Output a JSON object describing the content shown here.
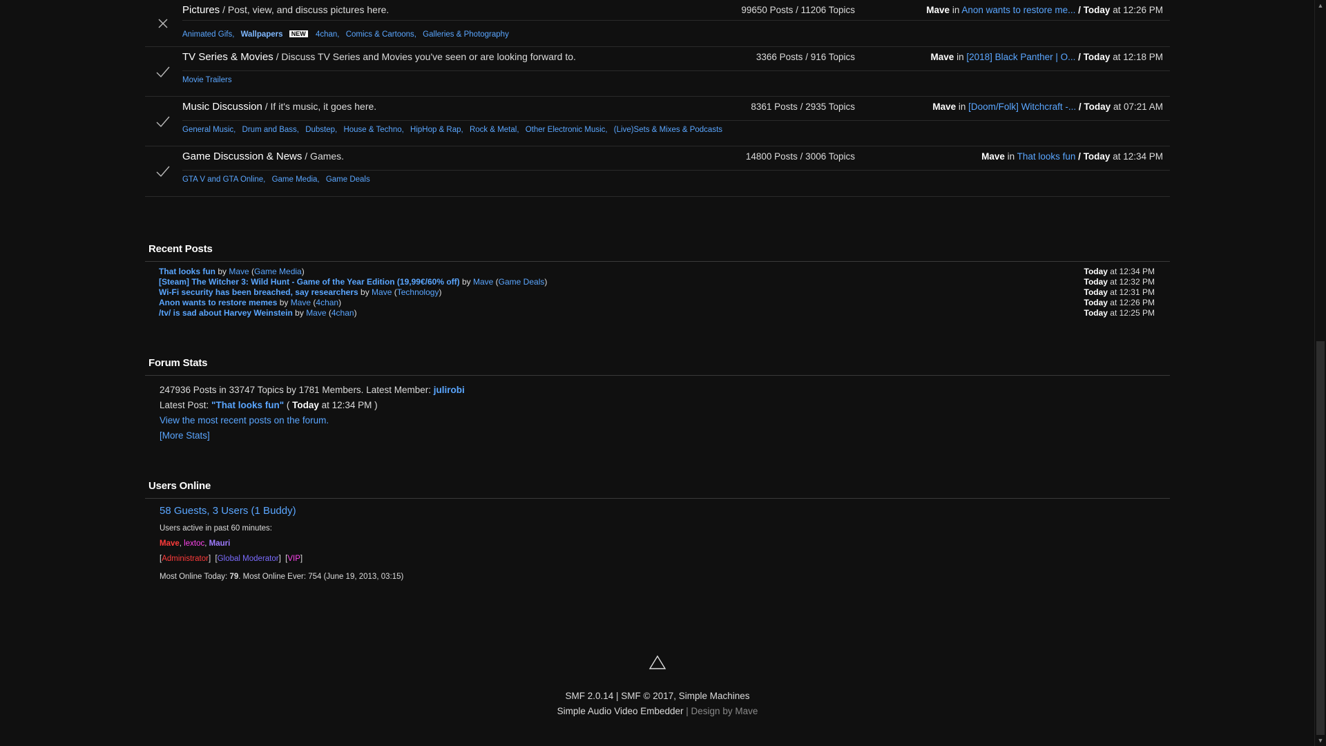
{
  "boards": [
    {
      "title": "Pictures",
      "desc": " / Post, view, and discuss pictures here.",
      "stats": "99650 Posts / 11206 Topics",
      "last_user": "Mave",
      "last_in": " in ",
      "last_topic": "Anon wants to restore me...",
      "last_sep": " / ",
      "last_day": "Today",
      "last_time": " at 12:26 PM",
      "icon": "x-icon",
      "children": [
        "Animated Gifs,",
        "Wallpapers",
        "4chan,",
        "Comics & Cartoons,",
        "Galleries & Photography"
      ],
      "new_badge": "NEW"
    },
    {
      "title": "TV Series & Movies",
      "desc": " / Discuss TV Series and Movies you've seen or are looking forward to.",
      "stats": "3366 Posts / 916 Topics",
      "last_user": "Mave",
      "last_in": " in ",
      "last_topic": "[2018] Black Panther | O...",
      "last_sep": " / ",
      "last_day": "Today",
      "last_time": " at 12:18 PM",
      "icon": "check-icon",
      "children": [
        "Movie Trailers"
      ]
    },
    {
      "title": "Music Discussion",
      "desc": " / If it's music, it goes here.",
      "stats": "8361 Posts / 2935 Topics",
      "last_user": "Mave",
      "last_in": " in ",
      "last_topic": "[Doom/Folk] Witchcraft -...",
      "last_sep": " / ",
      "last_day": "Today",
      "last_time": " at 07:21 AM",
      "icon": "check-icon",
      "children": [
        "General Music,",
        "Drum and Bass,",
        "Dubstep,",
        "House & Techno,",
        "HipHop & Rap,",
        "Rock & Metal,",
        "Other Electronic Music,",
        "(Live)Sets & Mixes & Podcasts"
      ]
    },
    {
      "title": "Game Discussion & News",
      "desc": " / Games.",
      "stats": "14800 Posts / 3006 Topics",
      "last_user": "Mave",
      "last_in": " in ",
      "last_topic": "That looks fun",
      "last_sep": " / ",
      "last_day": "Today",
      "last_time": " at 12:34 PM",
      "icon": "check-icon",
      "children": [
        "GTA V and GTA Online,",
        "Game Media,",
        "Game Deals"
      ]
    }
  ],
  "recent": {
    "heading": "Recent Posts",
    "by": " by ",
    "items": [
      {
        "subject": "That looks fun",
        "user": "Mave",
        "board": "Game Media",
        "day": "Today",
        "time": " at 12:34 PM"
      },
      {
        "subject": "[Steam] The Witcher 3: Wild Hunt - Game of the Year Edition (19,99€/60% off)",
        "user": "Mave",
        "board": "Game Deals",
        "day": "Today",
        "time": " at 12:32 PM"
      },
      {
        "subject": "Wi-Fi security has been breached, say researchers",
        "user": "Mave",
        "board": "Technology",
        "day": "Today",
        "time": " at 12:31 PM"
      },
      {
        "subject": "Anon wants to restore memes",
        "user": "Mave",
        "board": "4chan",
        "day": "Today",
        "time": " at 12:26 PM"
      },
      {
        "subject": "/tv/ is sad about Harvey Weinstein",
        "user": "Mave",
        "board": "4chan",
        "day": "Today",
        "time": " at 12:25 PM"
      }
    ]
  },
  "stats": {
    "heading": "Forum Stats",
    "line1": "247936 Posts in 33747 Topics by 1781 Members. Latest Member: ",
    "latest_member": "julirobi",
    "latest_post_label": "Latest Post: ",
    "latest_post_link": "\"That looks fun\"",
    "latest_post_open": " ( ",
    "latest_post_day": "Today",
    "latest_post_time": " at 12:34 PM )",
    "recent_link": "View the most recent posts on the forum.",
    "more_stats": "[More Stats]"
  },
  "online": {
    "heading": "Users Online",
    "summary": "58 Guests, 3 Users (1 Buddy)",
    "active_label": "Users active in past 60 minutes:",
    "user1": "Mave",
    "user2": "lextoc",
    "user3": "Mauri",
    "sep": ", ",
    "group1": "Administrator",
    "group2": "Global Moderator",
    "group3": "VIP",
    "most_today_label": "Most Online Today: ",
    "most_today": "79",
    "most_ever": ". Most Online Ever: 754 (June 19, 2013, 03:15)"
  },
  "footer": {
    "line1": "SMF 2.0.14 | SMF © 2017, Simple Machines",
    "line2a": "Simple Audio Video Embedder",
    "line2b": " | Design by Mave",
    "top_icon": "triangle-up-icon"
  }
}
